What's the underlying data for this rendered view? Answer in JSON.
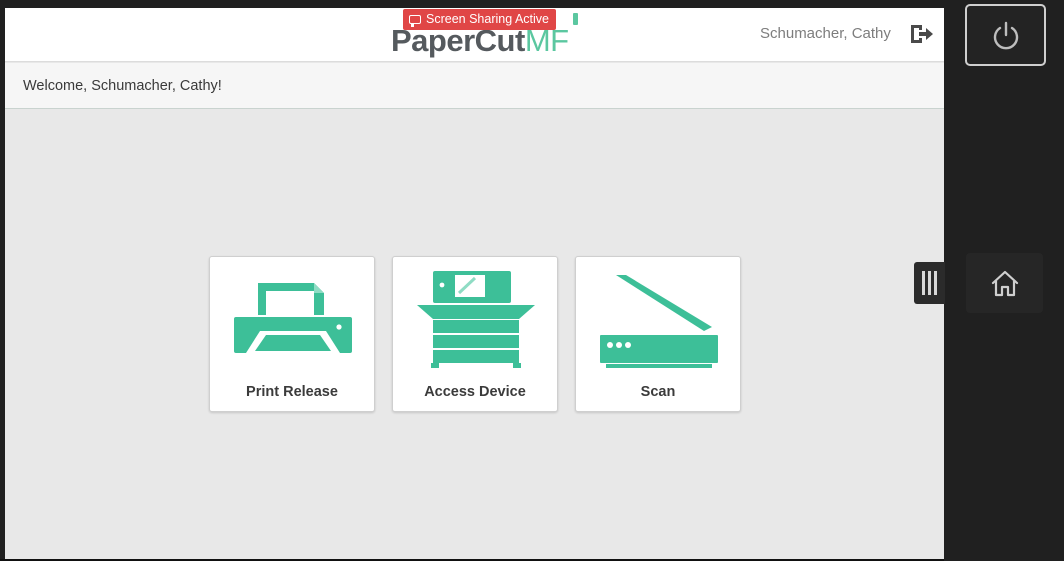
{
  "header": {
    "logo_main": "PaperCut",
    "logo_suffix": "MF",
    "screen_share_badge": "Screen Sharing Active",
    "username": "Schumacher, Cathy"
  },
  "welcome": {
    "text": "Welcome, Schumacher, Cathy!"
  },
  "tiles": [
    {
      "label": "Print Release",
      "icon": "printer-icon"
    },
    {
      "label": "Access Device",
      "icon": "copier-icon"
    },
    {
      "label": "Scan",
      "icon": "scanner-icon"
    }
  ],
  "colors": {
    "accent": "#3dbf98",
    "badge": "#e04646",
    "logo_gray": "#555a5e"
  }
}
